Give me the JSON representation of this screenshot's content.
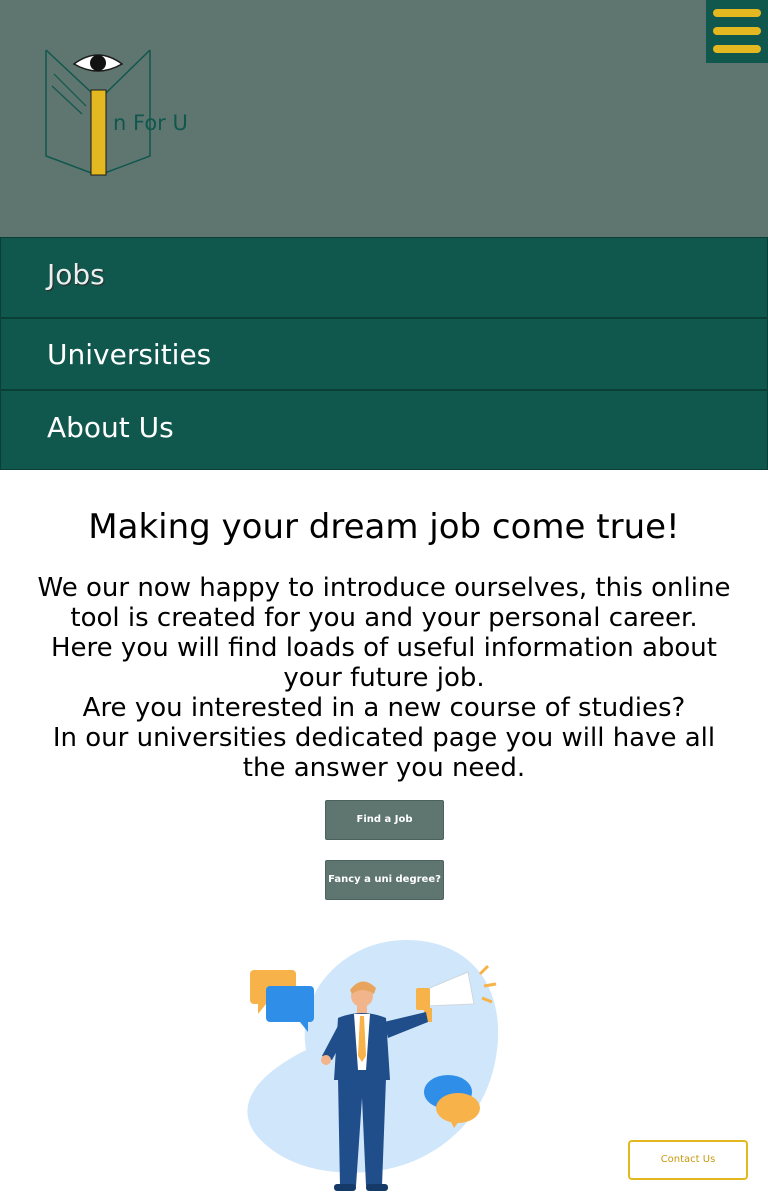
{
  "header": {
    "logo_text": "n For U",
    "menu_icon": "hamburger-menu-icon",
    "colors": {
      "background": "#5f7670",
      "brand_green": "#10574d",
      "accent_yellow": "#e3b820"
    }
  },
  "nav": {
    "items": [
      {
        "label": "Jobs"
      },
      {
        "label": "Universities"
      },
      {
        "label": "About Us"
      }
    ]
  },
  "main": {
    "title": "Making your dream job come true!",
    "paragraph_lines": [
      "We our now happy to introduce ourselves, this online tool is created for you and your personal career.",
      "Here you will find loads of useful information about your future job.",
      "Are you interested in a new course of studies?",
      "In our universities dedicated page you will have all the answer you need."
    ],
    "buttons": {
      "find_job": "Find a Job",
      "uni_degree": "Fancy a uni degree?"
    },
    "illustration_icon": "businessman-megaphone-illustration"
  },
  "footer": {
    "contact_label": "Contact Us"
  }
}
